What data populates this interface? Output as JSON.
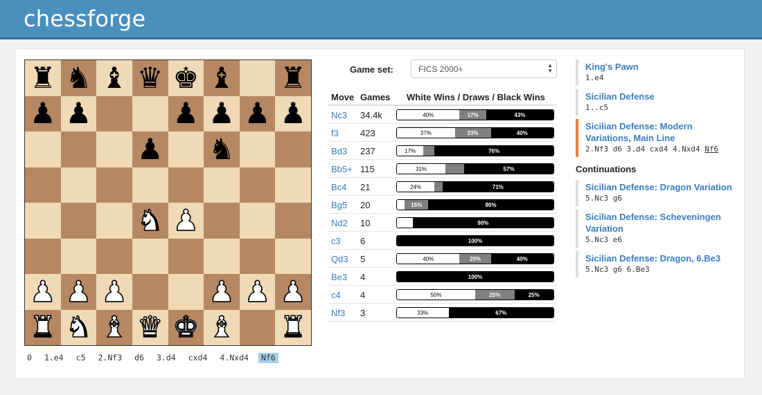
{
  "app": {
    "brand": "chessforge"
  },
  "board": {
    "ranks": [
      [
        "bR",
        "bN",
        "bB",
        "bQ",
        "bK",
        "bB",
        "",
        "bR"
      ],
      [
        "bP",
        "bP",
        "",
        "",
        "bP",
        "bP",
        "bP",
        "bP"
      ],
      [
        "",
        "",
        "",
        "bP",
        "",
        "bN",
        "",
        ""
      ],
      [
        "",
        "",
        "",
        "",
        "",
        "",
        "",
        ""
      ],
      [
        "",
        "",
        "",
        "wN",
        "wP",
        "",
        "",
        ""
      ],
      [
        "",
        "",
        "",
        "",
        "",
        "",
        "",
        ""
      ],
      [
        "wP",
        "wP",
        "wP",
        "",
        "",
        "wP",
        "wP",
        "wP"
      ],
      [
        "wR",
        "wN",
        "wB",
        "wQ",
        "wK",
        "wB",
        "",
        "wR"
      ]
    ],
    "glyphs": {
      "bK": "♚",
      "bQ": "♛",
      "bR": "♜",
      "bB": "♝",
      "bN": "♞",
      "bP": "♟",
      "wK": "♚",
      "wQ": "♛",
      "wR": "♜",
      "wB": "♝",
      "wN": "♞",
      "wP": "♟"
    }
  },
  "history": [
    "0",
    "1.e4",
    "c5",
    "2.Nf3",
    "d6",
    "3.d4",
    "cxd4",
    "4.Nxd4",
    "Nf6"
  ],
  "history_current": 8,
  "gameset": {
    "label": "Game set:",
    "value": "FICS 2000+"
  },
  "moves_table": {
    "headers": {
      "move": "Move",
      "games": "Games",
      "results": "White Wins / Draws / Black Wins"
    },
    "rows": [
      {
        "move": "Nc3",
        "games": "34.4k",
        "w": 40,
        "d": 17,
        "b": 43,
        "wl": "40%",
        "dl": "17%",
        "bl": "43%"
      },
      {
        "move": "f3",
        "games": "423",
        "w": 37,
        "d": 23,
        "b": 40,
        "wl": "37%",
        "dl": "23%",
        "bl": "40%"
      },
      {
        "move": "Bd3",
        "games": "237",
        "w": 17,
        "d": 7,
        "b": 76,
        "wl": "17%",
        "dl": "",
        "bl": "76%"
      },
      {
        "move": "Bb5+",
        "games": "115",
        "w": 31,
        "d": 12,
        "b": 57,
        "wl": "31%",
        "dl": "",
        "bl": "57%"
      },
      {
        "move": "Bc4",
        "games": "21",
        "w": 24,
        "d": 5,
        "b": 71,
        "wl": "24%",
        "dl": "",
        "bl": "71%"
      },
      {
        "move": "Bg5",
        "games": "20",
        "w": 5,
        "d": 15,
        "b": 80,
        "wl": "",
        "dl": "15%",
        "bl": "80%"
      },
      {
        "move": "Nd2",
        "games": "10",
        "w": 10,
        "d": 0,
        "b": 90,
        "wl": "",
        "dl": "",
        "bl": "90%"
      },
      {
        "move": "c3",
        "games": "6",
        "w": 0,
        "d": 0,
        "b": 100,
        "wl": "",
        "dl": "",
        "bl": "100%"
      },
      {
        "move": "Qd3",
        "games": "5",
        "w": 40,
        "d": 20,
        "b": 40,
        "wl": "40%",
        "dl": "20%",
        "bl": "40%"
      },
      {
        "move": "Be3",
        "games": "4",
        "w": 0,
        "d": 0,
        "b": 100,
        "wl": "",
        "dl": "",
        "bl": "100%"
      },
      {
        "move": "c4",
        "games": "4",
        "w": 50,
        "d": 25,
        "b": 25,
        "wl": "50%",
        "dl": "25%",
        "bl": "25%"
      },
      {
        "move": "Nf3",
        "games": "3",
        "w": 33,
        "d": 0,
        "b": 67,
        "wl": "33%",
        "dl": "",
        "bl": "67%"
      }
    ]
  },
  "openings": [
    {
      "name": "King's Pawn",
      "moves": "1.e4",
      "last": "",
      "active": false
    },
    {
      "name": "Sicilian Defense",
      "moves": "1..c5",
      "last": "",
      "active": false
    },
    {
      "name": "Sicilian Defense: Modern Variations, Main Line",
      "moves": "2.Nf3 d6 3.d4 cxd4 4.Nxd4 ",
      "last": "Nf6",
      "active": true
    }
  ],
  "continuations_title": "Continuations",
  "continuations": [
    {
      "name": "Sicilian Defense: Dragon Variation",
      "moves": "5.Nc3 g6"
    },
    {
      "name": "Sicilian Defense: Scheveningen Variation",
      "moves": "5.Nc3 e6"
    },
    {
      "name": "Sicilian Defense: Dragon, 6.Be3",
      "moves": "5.Nc3 g6 6.Be3"
    }
  ],
  "colors": {
    "navbar": "#4a90bf",
    "link": "#3a7dbf",
    "active_border": "#e67e3c",
    "light_square": "#f0d9b5",
    "dark_square": "#b58863"
  }
}
